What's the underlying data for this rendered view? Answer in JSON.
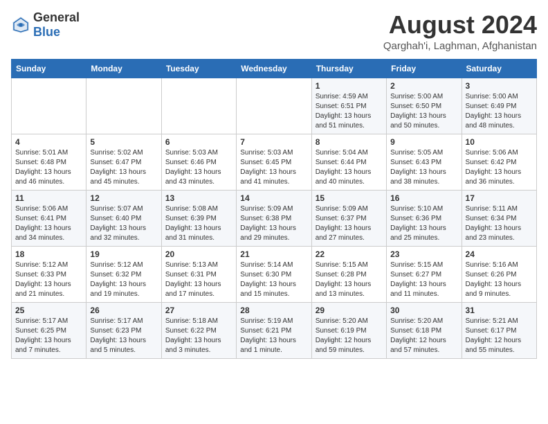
{
  "header": {
    "logo_general": "General",
    "logo_blue": "Blue",
    "main_title": "August 2024",
    "subtitle": "Qarghah'i, Laghman, Afghanistan"
  },
  "calendar": {
    "days_of_week": [
      "Sunday",
      "Monday",
      "Tuesday",
      "Wednesday",
      "Thursday",
      "Friday",
      "Saturday"
    ],
    "weeks": [
      [
        {
          "day": "",
          "info": ""
        },
        {
          "day": "",
          "info": ""
        },
        {
          "day": "",
          "info": ""
        },
        {
          "day": "",
          "info": ""
        },
        {
          "day": "1",
          "info": "Sunrise: 4:59 AM\nSunset: 6:51 PM\nDaylight: 13 hours\nand 51 minutes."
        },
        {
          "day": "2",
          "info": "Sunrise: 5:00 AM\nSunset: 6:50 PM\nDaylight: 13 hours\nand 50 minutes."
        },
        {
          "day": "3",
          "info": "Sunrise: 5:00 AM\nSunset: 6:49 PM\nDaylight: 13 hours\nand 48 minutes."
        }
      ],
      [
        {
          "day": "4",
          "info": "Sunrise: 5:01 AM\nSunset: 6:48 PM\nDaylight: 13 hours\nand 46 minutes."
        },
        {
          "day": "5",
          "info": "Sunrise: 5:02 AM\nSunset: 6:47 PM\nDaylight: 13 hours\nand 45 minutes."
        },
        {
          "day": "6",
          "info": "Sunrise: 5:03 AM\nSunset: 6:46 PM\nDaylight: 13 hours\nand 43 minutes."
        },
        {
          "day": "7",
          "info": "Sunrise: 5:03 AM\nSunset: 6:45 PM\nDaylight: 13 hours\nand 41 minutes."
        },
        {
          "day": "8",
          "info": "Sunrise: 5:04 AM\nSunset: 6:44 PM\nDaylight: 13 hours\nand 40 minutes."
        },
        {
          "day": "9",
          "info": "Sunrise: 5:05 AM\nSunset: 6:43 PM\nDaylight: 13 hours\nand 38 minutes."
        },
        {
          "day": "10",
          "info": "Sunrise: 5:06 AM\nSunset: 6:42 PM\nDaylight: 13 hours\nand 36 minutes."
        }
      ],
      [
        {
          "day": "11",
          "info": "Sunrise: 5:06 AM\nSunset: 6:41 PM\nDaylight: 13 hours\nand 34 minutes."
        },
        {
          "day": "12",
          "info": "Sunrise: 5:07 AM\nSunset: 6:40 PM\nDaylight: 13 hours\nand 32 minutes."
        },
        {
          "day": "13",
          "info": "Sunrise: 5:08 AM\nSunset: 6:39 PM\nDaylight: 13 hours\nand 31 minutes."
        },
        {
          "day": "14",
          "info": "Sunrise: 5:09 AM\nSunset: 6:38 PM\nDaylight: 13 hours\nand 29 minutes."
        },
        {
          "day": "15",
          "info": "Sunrise: 5:09 AM\nSunset: 6:37 PM\nDaylight: 13 hours\nand 27 minutes."
        },
        {
          "day": "16",
          "info": "Sunrise: 5:10 AM\nSunset: 6:36 PM\nDaylight: 13 hours\nand 25 minutes."
        },
        {
          "day": "17",
          "info": "Sunrise: 5:11 AM\nSunset: 6:34 PM\nDaylight: 13 hours\nand 23 minutes."
        }
      ],
      [
        {
          "day": "18",
          "info": "Sunrise: 5:12 AM\nSunset: 6:33 PM\nDaylight: 13 hours\nand 21 minutes."
        },
        {
          "day": "19",
          "info": "Sunrise: 5:12 AM\nSunset: 6:32 PM\nDaylight: 13 hours\nand 19 minutes."
        },
        {
          "day": "20",
          "info": "Sunrise: 5:13 AM\nSunset: 6:31 PM\nDaylight: 13 hours\nand 17 minutes."
        },
        {
          "day": "21",
          "info": "Sunrise: 5:14 AM\nSunset: 6:30 PM\nDaylight: 13 hours\nand 15 minutes."
        },
        {
          "day": "22",
          "info": "Sunrise: 5:15 AM\nSunset: 6:28 PM\nDaylight: 13 hours\nand 13 minutes."
        },
        {
          "day": "23",
          "info": "Sunrise: 5:15 AM\nSunset: 6:27 PM\nDaylight: 13 hours\nand 11 minutes."
        },
        {
          "day": "24",
          "info": "Sunrise: 5:16 AM\nSunset: 6:26 PM\nDaylight: 13 hours\nand 9 minutes."
        }
      ],
      [
        {
          "day": "25",
          "info": "Sunrise: 5:17 AM\nSunset: 6:25 PM\nDaylight: 13 hours\nand 7 minutes."
        },
        {
          "day": "26",
          "info": "Sunrise: 5:17 AM\nSunset: 6:23 PM\nDaylight: 13 hours\nand 5 minutes."
        },
        {
          "day": "27",
          "info": "Sunrise: 5:18 AM\nSunset: 6:22 PM\nDaylight: 13 hours\nand 3 minutes."
        },
        {
          "day": "28",
          "info": "Sunrise: 5:19 AM\nSunset: 6:21 PM\nDaylight: 13 hours\nand 1 minute."
        },
        {
          "day": "29",
          "info": "Sunrise: 5:20 AM\nSunset: 6:19 PM\nDaylight: 12 hours\nand 59 minutes."
        },
        {
          "day": "30",
          "info": "Sunrise: 5:20 AM\nSunset: 6:18 PM\nDaylight: 12 hours\nand 57 minutes."
        },
        {
          "day": "31",
          "info": "Sunrise: 5:21 AM\nSunset: 6:17 PM\nDaylight: 12 hours\nand 55 minutes."
        }
      ]
    ]
  }
}
